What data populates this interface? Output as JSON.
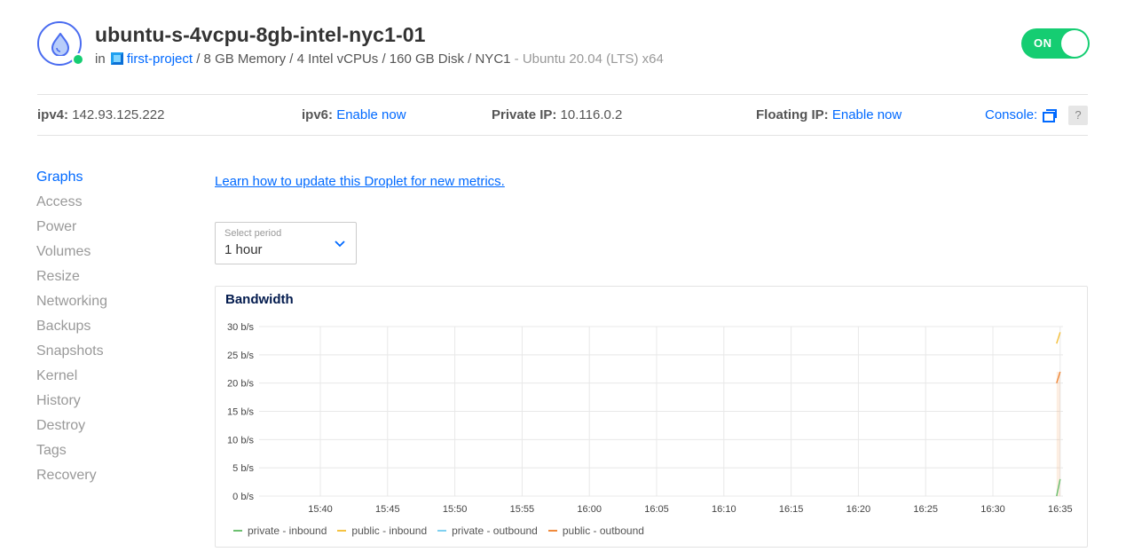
{
  "droplet": {
    "name": "ubuntu-s-4vcpu-8gb-intel-nyc1-01",
    "in_label": "in",
    "project": "first-project",
    "specs": "/ 8 GB Memory / 4 Intel vCPUs / 160 GB Disk / NYC1",
    "os": "- Ubuntu 20.04 (LTS) x64",
    "power_toggle": "ON"
  },
  "infobar": {
    "ipv4_label": "ipv4:",
    "ipv4_value": "142.93.125.222",
    "ipv6_label": "ipv6:",
    "ipv6_link": "Enable now",
    "private_label": "Private IP:",
    "private_value": "10.116.0.2",
    "floating_label": "Floating IP:",
    "floating_link": "Enable now",
    "console_label": "Console:",
    "help_label": "?"
  },
  "sidebar": {
    "items": [
      {
        "label": "Graphs",
        "active": true
      },
      {
        "label": "Access"
      },
      {
        "label": "Power"
      },
      {
        "label": "Volumes"
      },
      {
        "label": "Resize"
      },
      {
        "label": "Networking"
      },
      {
        "label": "Backups"
      },
      {
        "label": "Snapshots"
      },
      {
        "label": "Kernel"
      },
      {
        "label": "History"
      },
      {
        "label": "Destroy"
      },
      {
        "label": "Tags"
      },
      {
        "label": "Recovery"
      }
    ]
  },
  "metrics_link": "Learn how to update this Droplet for new metrics.",
  "period": {
    "label": "Select period",
    "value": "1 hour"
  },
  "colors": {
    "accent": "#0069ff",
    "on_green": "#15cd72",
    "private_inbound": "#6cc070",
    "public_inbound": "#f5c242",
    "private_outbound": "#7fd0f0",
    "public_outbound": "#f08a3c"
  },
  "chart_data": {
    "type": "line",
    "title": "Bandwidth",
    "x_ticks": [
      "15:40",
      "15:45",
      "15:50",
      "15:55",
      "16:00",
      "16:05",
      "16:10",
      "16:15",
      "16:20",
      "16:25",
      "16:30",
      "16:35"
    ],
    "y_ticks": [
      "0 b/s",
      "5 b/s",
      "10 b/s",
      "15 b/s",
      "20 b/s",
      "25 b/s",
      "30 b/s"
    ],
    "ylim": [
      0,
      30
    ],
    "grid": true,
    "legend_position": "bottom",
    "series": [
      {
        "name": "private - inbound",
        "color": "#6cc070",
        "points": [
          {
            "x": "16:35",
            "y": 0
          },
          {
            "x": "16:35",
            "y": 3
          }
        ]
      },
      {
        "name": "public - inbound",
        "color": "#f5c242",
        "points": [
          {
            "x": "16:35",
            "y": 27
          },
          {
            "x": "16:35",
            "y": 29
          }
        ]
      },
      {
        "name": "private - outbound",
        "color": "#7fd0f0",
        "points": []
      },
      {
        "name": "public - outbound",
        "color": "#f08a3c",
        "points": [
          {
            "x": "16:35",
            "y": 20
          },
          {
            "x": "16:35",
            "y": 22
          }
        ]
      }
    ]
  }
}
